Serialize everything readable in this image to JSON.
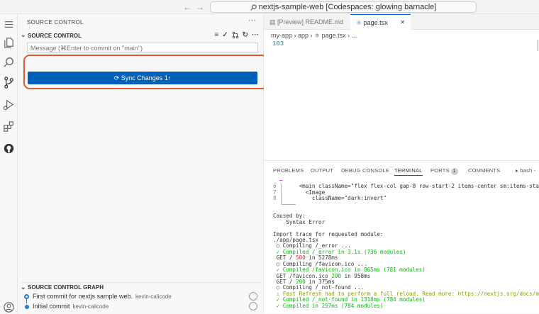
{
  "titlebar": {
    "nav_back": "←",
    "nav_forward": "→",
    "command_center": "nextjs-sample-web [Codespaces: glowing barnacle]"
  },
  "sidebar": {
    "title": "SOURCE CONTROL",
    "more": "···",
    "section_title": "SOURCE CONTROL",
    "message_placeholder": "Message (⌘Enter to commit on \"main\")",
    "sync_label": "Sync Changes 1↑",
    "graph_title": "SOURCE CONTROL GRAPH",
    "commits": [
      {
        "message": "First commit for nextjs sample web.",
        "author": "kevin-calicode"
      },
      {
        "message": "Initial commit",
        "author": "kevin-calicode"
      }
    ]
  },
  "editor": {
    "tabs": [
      {
        "label": "[Preview] README.md"
      },
      {
        "label": "page.tsx",
        "close": "✕"
      }
    ],
    "breadcrumb": "my-app › app › ⚛ page.tsx › ...",
    "line_number": "103"
  },
  "panel": {
    "tabs": [
      "PROBLEMS",
      "OUTPUT",
      "DEBUG CONSOLE",
      "TERMINAL",
      "PORTS",
      "COMMENTS"
    ],
    "ports_count": "1",
    "shell": "bash -",
    "terminal": {
      "code_lines": [
        {
          "no": "6",
          "text": "    <main className=\"flex flex-col gap-8 row-start-2 items-center sm:items-sta"
        },
        {
          "no": "7",
          "text": "      <Image"
        },
        {
          "no": "8",
          "text": "        className=\"dark:invert\""
        }
      ],
      "caused_by": "Caused by:",
      "syntax_error": "    Syntax Error",
      "import_trace": "Import trace for requested module:",
      "trace_file": "./app/page.tsx",
      "compiling_error": " ○ Compiling /_error ...",
      "compiled_error": " ✓ Compiled /_error in 3.1s (736 modules)",
      "get_500_method": " GET / ",
      "get_500_code": "500",
      "get_500_tail": " in 5278ms",
      "compiling_favicon": " ○ Compiling /favicon.ico ...",
      "compiled_favicon": " ✓ Compiled /favicon.ico in 865ms (781 modules)",
      "get_favicon_method": " GET /favicon.ico ",
      "get_favicon_code": "200",
      "get_favicon_tail": " in 958ms",
      "get_200_method": " GET / ",
      "get_200_code": "200",
      "get_200_tail": " in 375ms",
      "compiling_notfound": " ○ Compiling /_not-found ...",
      "fast_refresh": " ⚠ Fast Refresh had to perform a full reload. Read more: https://nextjs.org/docs/mess",
      "compiled_notfound": " ✓ Compiled /_not-found in 1318ms (784 modules)",
      "compiled_last": " ✓ Compiled in 257ms (784 modules)"
    }
  }
}
